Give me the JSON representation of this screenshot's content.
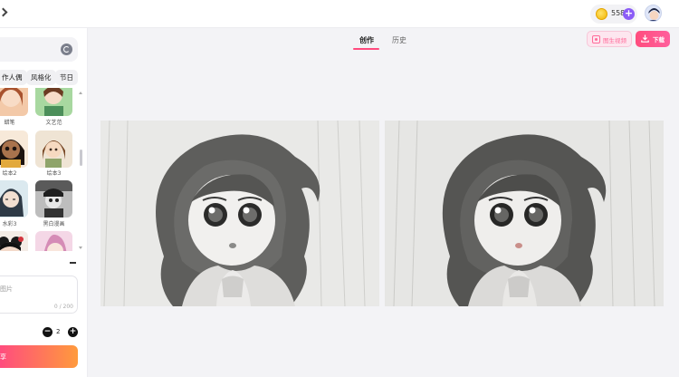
{
  "header": {
    "coins": "558"
  },
  "sidebar": {
    "categories": [
      "作人偶",
      "风格化",
      "节日"
    ],
    "styles": [
      {
        "label": "蜡笔"
      },
      {
        "label": "文艺范"
      },
      {
        "label": "绘本2"
      },
      {
        "label": "绘本3"
      },
      {
        "label": "水彩3"
      },
      {
        "label": "黑白漫画"
      },
      {
        "label": ""
      },
      {
        "label": ""
      }
    ],
    "prompt": {
      "placeholder": "图片",
      "counter": "0 / 200"
    },
    "quantity": "2",
    "generate_label": "享"
  },
  "main": {
    "tabs": [
      {
        "label": "创作",
        "active": true
      },
      {
        "label": "历史",
        "active": false
      }
    ],
    "actions": {
      "image_to_video_label": "图生视频",
      "download_label": "下载"
    }
  },
  "colors": {
    "accent": "#ff4a7e",
    "purple": "#8b5cf6"
  },
  "icons": [
    "back-chevron-icon",
    "coin-icon",
    "plus-icon",
    "refresh-icon",
    "minus-icon",
    "video-icon",
    "download-icon"
  ]
}
